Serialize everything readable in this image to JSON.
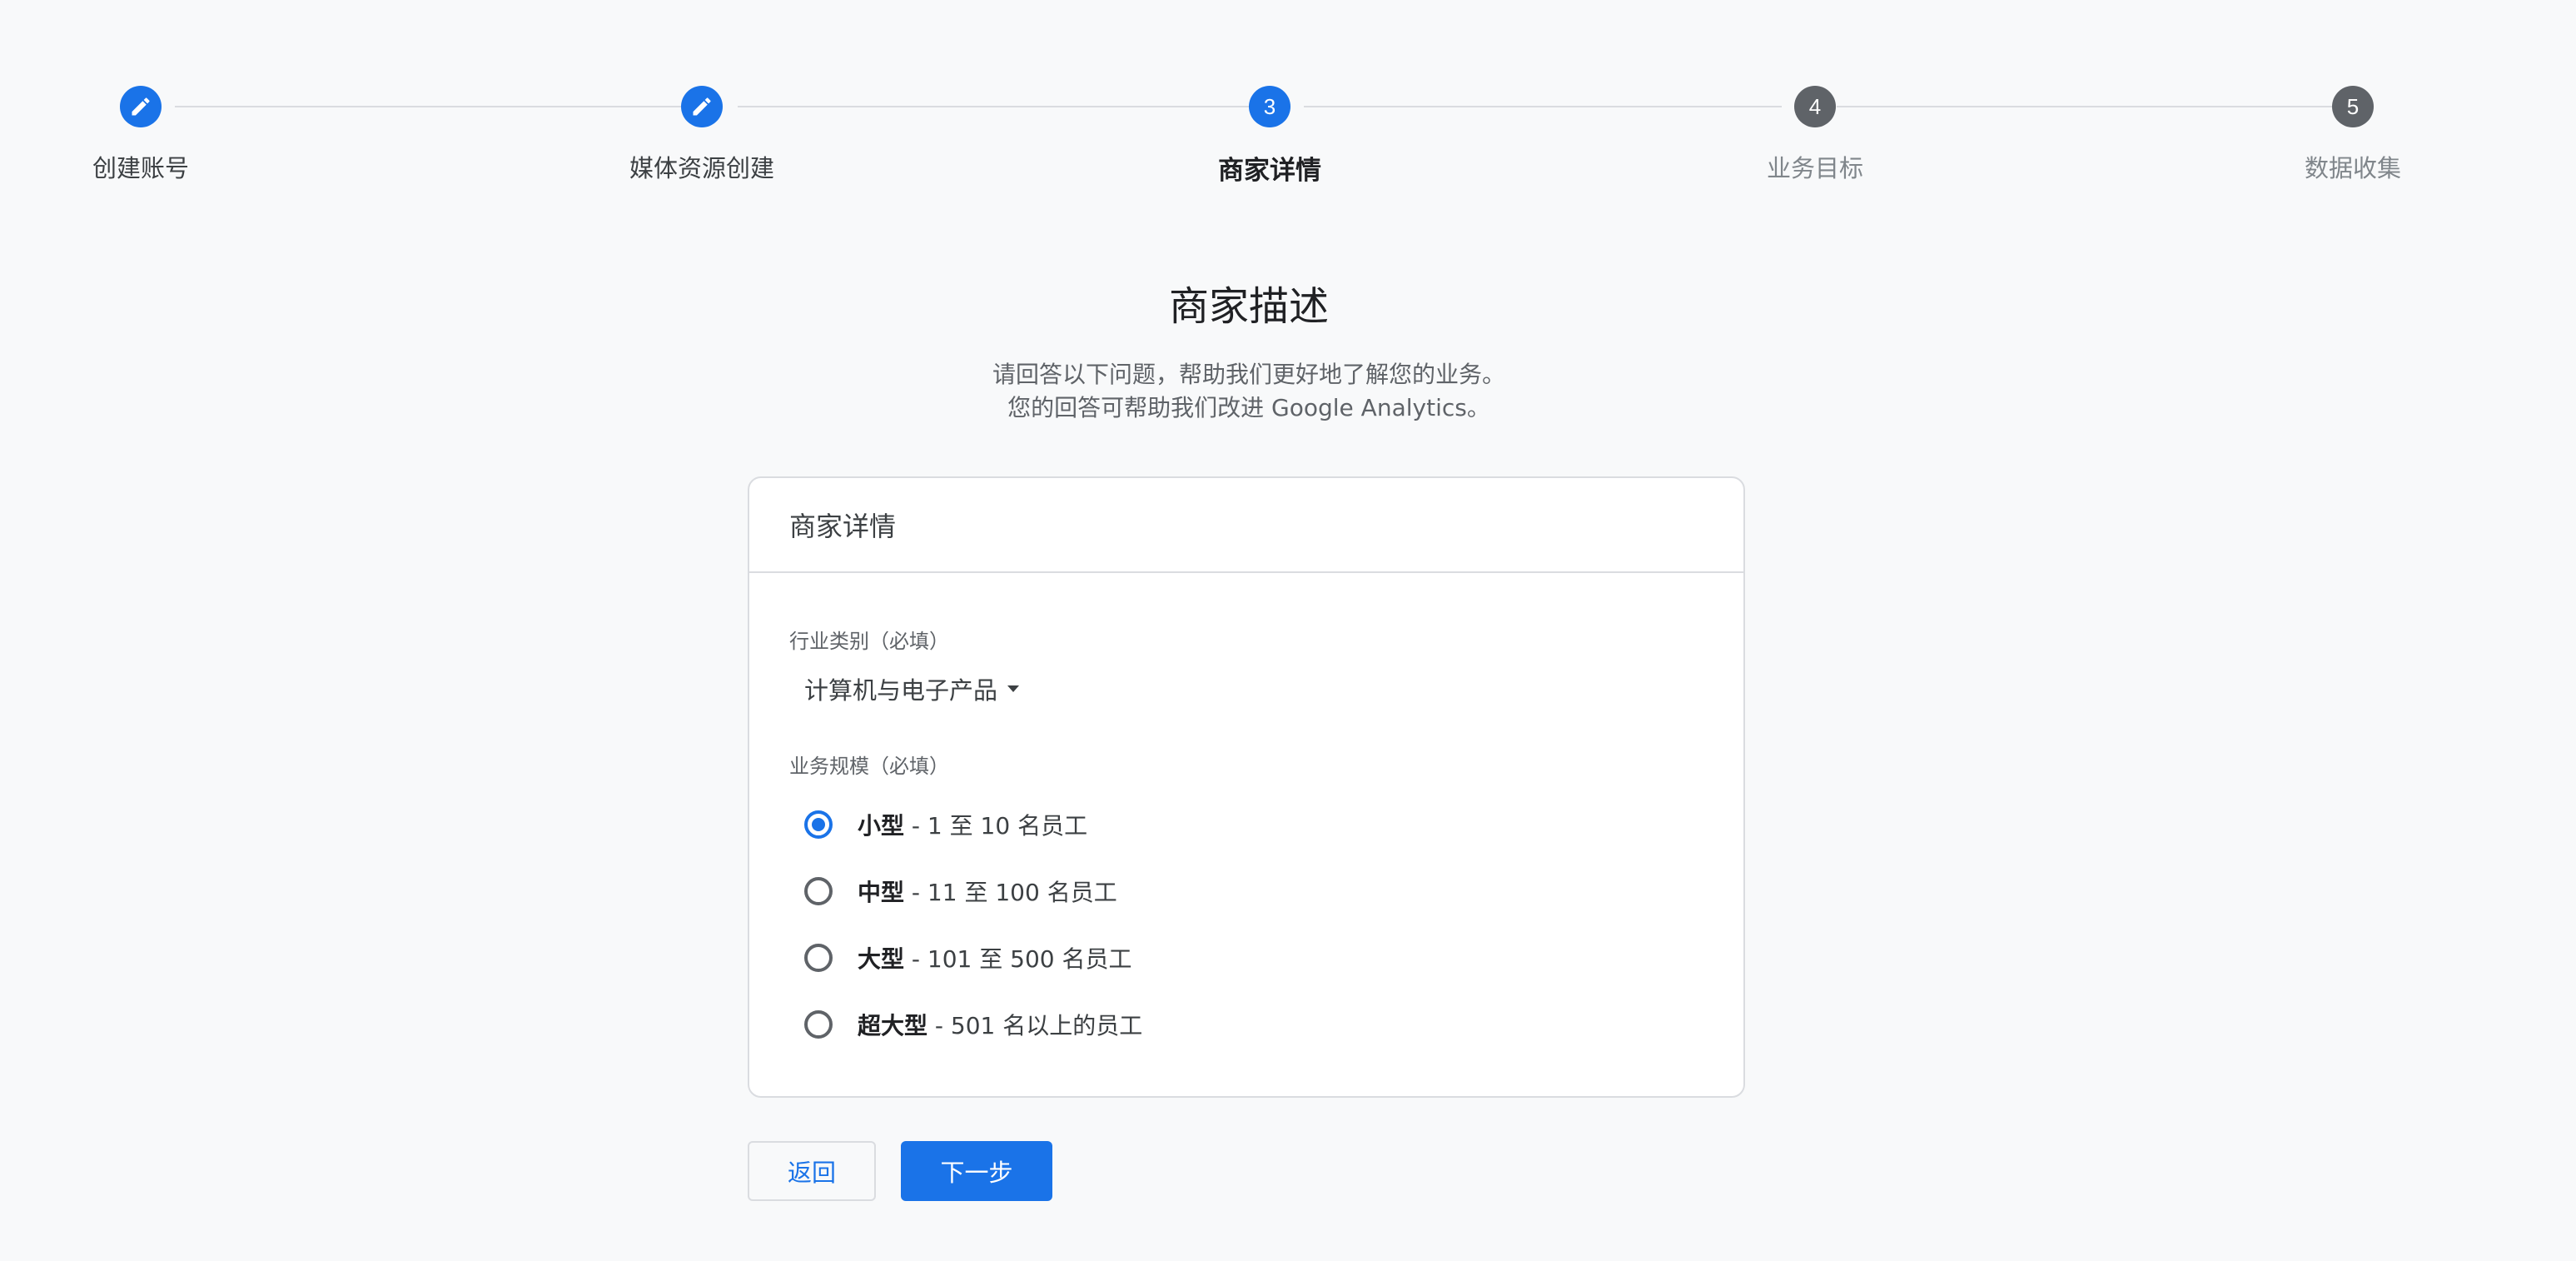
{
  "stepper": {
    "steps": [
      {
        "label": "创建账号",
        "number": "1",
        "state": "done"
      },
      {
        "label": "媒体资源创建",
        "number": "2",
        "state": "done"
      },
      {
        "label": "商家详情",
        "number": "3",
        "state": "active"
      },
      {
        "label": "业务目标",
        "number": "4",
        "state": "pending"
      },
      {
        "label": "数据收集",
        "number": "5",
        "state": "pending"
      }
    ]
  },
  "header": {
    "title": "商家描述",
    "subtitle_line1": "请回答以下问题，帮助我们更好地了解您的业务。",
    "subtitle_line2": "您的回答可帮助我们改进 Google Analytics。"
  },
  "card": {
    "title": "商家详情",
    "industry_label": "行业类别（必填）",
    "industry_value": "计算机与电子产品",
    "size_label": "业务规模（必填）",
    "size_options": [
      {
        "name": "小型",
        "desc": " - 1 至 10 名员工",
        "checked": true
      },
      {
        "name": "中型",
        "desc": " - 11 至 100 名员工",
        "checked": false
      },
      {
        "name": "大型",
        "desc": " - 101 至 500 名员工",
        "checked": false
      },
      {
        "name": "超大型",
        "desc": " - 501 名以上的员工",
        "checked": false
      }
    ]
  },
  "buttons": {
    "back_label": "返回",
    "next_label": "下一步"
  },
  "colors": {
    "accent": "#1a73e8",
    "pending": "#5f6368",
    "background": "#f8f9fa"
  },
  "icons": {
    "done_step": "pencil-icon",
    "dropdown": "caret-down-icon"
  }
}
